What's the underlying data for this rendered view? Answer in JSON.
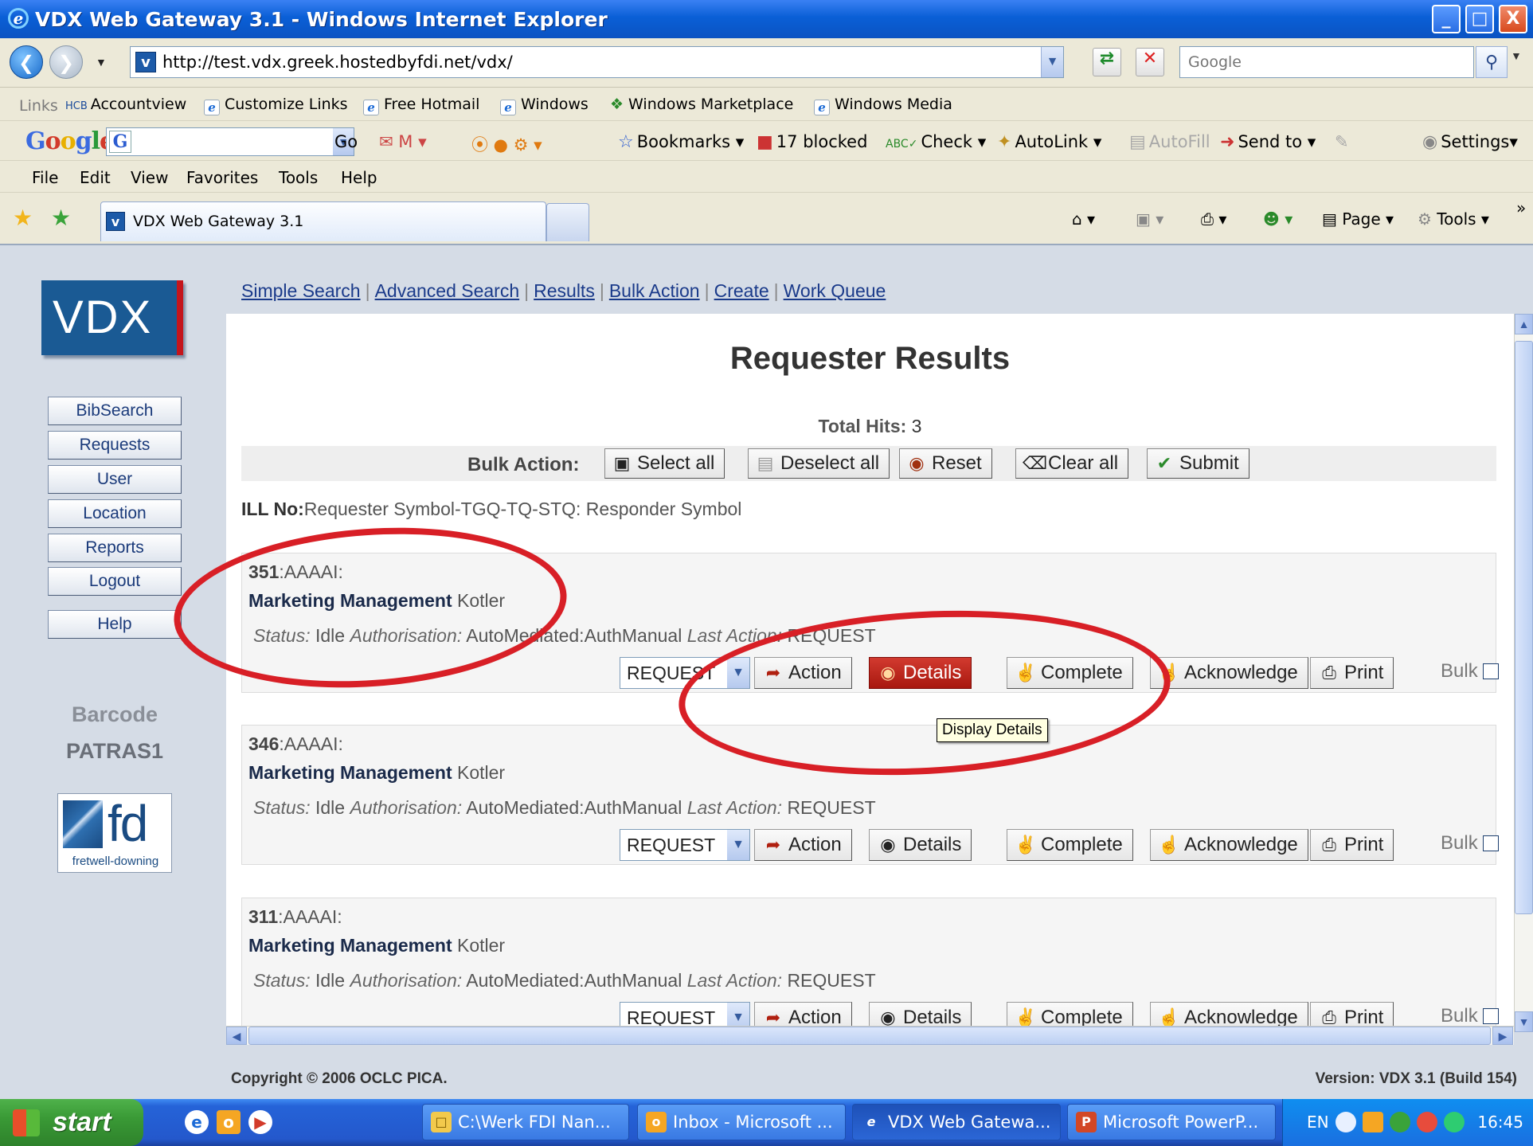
{
  "window": {
    "title": "VDX Web Gateway 3.1 - Windows Internet Explorer",
    "controls": {
      "minimize": "_",
      "maximize": "□",
      "close": "X"
    }
  },
  "address_bar": {
    "url": "http://test.vdx.greek.hostedbyfdi.net/vdx/",
    "search_placeholder": "Google"
  },
  "links_bar": {
    "label": "Links",
    "items": [
      "Accountview",
      "Customize Links",
      "Free Hotmail",
      "Windows",
      "Windows Marketplace",
      "Windows Media"
    ]
  },
  "google_toolbar": {
    "logo": "Google",
    "go": "Go",
    "bookmarks": "Bookmarks",
    "blocked": "17 blocked",
    "check": "Check",
    "autolink": "AutoLink",
    "autofill": "AutoFill",
    "send_to": "Send to",
    "settings": "Settings"
  },
  "menu": [
    "File",
    "Edit",
    "View",
    "Favorites",
    "Tools",
    "Help"
  ],
  "tab": {
    "title": "VDX Web Gateway 3.1"
  },
  "command_bar": {
    "page": "Page",
    "tools": "Tools"
  },
  "sidebar": {
    "logo": "VDX",
    "buttons": [
      "BibSearch",
      "Requests",
      "User",
      "Location",
      "Reports",
      "Logout",
      "Help"
    ],
    "barcode_label": "Barcode",
    "barcode_value": "PATRAS1",
    "partner_logo": {
      "mark": "fd",
      "caption": "fretwell-downing"
    }
  },
  "top_nav": [
    "Simple Search",
    "Advanced Search",
    "Results",
    "Bulk Action",
    "Create",
    "Work Queue"
  ],
  "page": {
    "title": "Requester Results",
    "total_hits_label": "Total Hits:",
    "total_hits": "3",
    "bulk_action_label": "Bulk Action:",
    "bulk_buttons": [
      "Select all",
      "Deselect all",
      "Reset",
      "Clear all",
      "Submit"
    ],
    "ill_no_label": "ILL No:",
    "ill_no_format": "Requester Symbol-TGQ-TQ-STQ: Responder Symbol"
  },
  "records": [
    {
      "id": "351",
      "code": ":AAAAI:",
      "title": "Marketing Management",
      "author": "Kotler",
      "status_label": "Status:",
      "status": "Idle",
      "auth_label": "Authorisation:",
      "auth": "AutoMediated:AuthManual",
      "last_label": "Last Action:",
      "last": "REQUEST",
      "select": "REQUEST"
    },
    {
      "id": "346",
      "code": ":AAAAI:",
      "title": "Marketing Management",
      "author": "Kotler",
      "status_label": "Status:",
      "status": "Idle",
      "auth_label": "Authorisation:",
      "auth": "AutoMediated:AuthManual",
      "last_label": "Last Action:",
      "last": "REQUEST",
      "select": "REQUEST"
    },
    {
      "id": "311",
      "code": ":AAAAI:",
      "title": "Marketing Management",
      "author": "Kotler",
      "status_label": "Status:",
      "status": "Idle",
      "auth_label": "Authorisation:",
      "auth": "AutoMediated:AuthManual",
      "last_label": "Last Action:",
      "last": "REQUEST",
      "select": "REQUEST"
    }
  ],
  "record_buttons": {
    "action": "Action",
    "details": "Details",
    "complete": "Complete",
    "acknowledge": "Acknowledge",
    "print": "Print",
    "bulk": "Bulk"
  },
  "tooltip": "Display Details",
  "footer": {
    "copyright": "Copyright © 2006 OCLC PICA.",
    "version": "Version: VDX 3.1 (Build 154)"
  },
  "taskbar": {
    "start": "start",
    "tasks": [
      "C:\\Werk FDI Nan...",
      "Inbox - Microsoft ...",
      "VDX Web Gatewa...",
      "Microsoft PowerP..."
    ],
    "lang": "EN",
    "clock": "16:45"
  },
  "colors": {
    "accent_red": "#d81f26",
    "vdx_blue": "#1a5a94",
    "xp_blue": "#2458cc"
  }
}
